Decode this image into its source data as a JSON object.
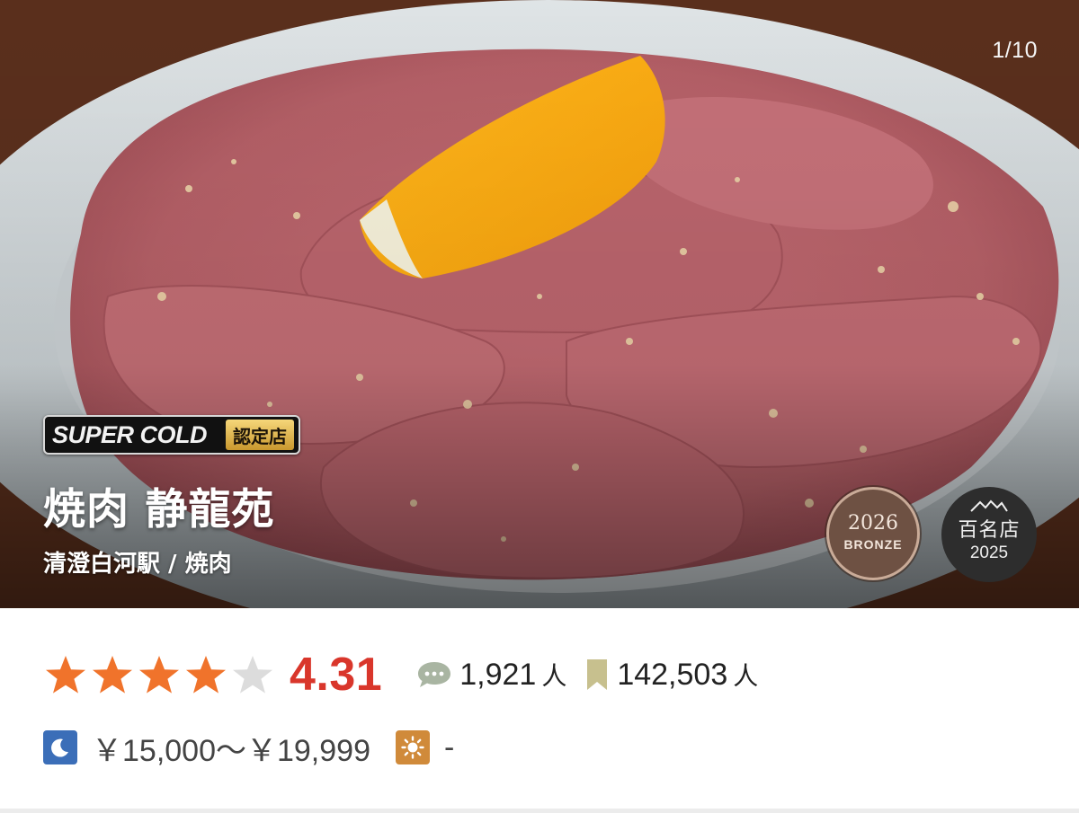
{
  "hero": {
    "photo_counter": "1/10",
    "super_cold_label": "SUPER COLD",
    "super_cold_cert": "認定店",
    "shop_name": "焼肉 静龍苑",
    "station_genre": "清澄白河駅 / 焼肉",
    "bronze_badge": {
      "year": "2026",
      "rank": "BRONZE"
    },
    "hyakumeiten_badge": {
      "label": "百名店",
      "year": "2025"
    }
  },
  "rating": {
    "stars": 4.31,
    "score": "4.31",
    "reviews": {
      "count": "1,921",
      "unit": "人",
      "icon": "comment-icon"
    },
    "saves": {
      "count": "142,503",
      "unit": "人",
      "icon": "bookmark-icon"
    }
  },
  "price": {
    "dinner_icon": "moon-icon",
    "dinner": "￥15,000～￥19,999",
    "lunch_icon": "sun-icon",
    "lunch": "-"
  },
  "colors": {
    "star_filled": "#f0732b",
    "star_empty": "#dcdcdc",
    "score": "#d9362b",
    "moon_bg": "#3b6eb8",
    "sun_bg": "#d08a3a"
  }
}
